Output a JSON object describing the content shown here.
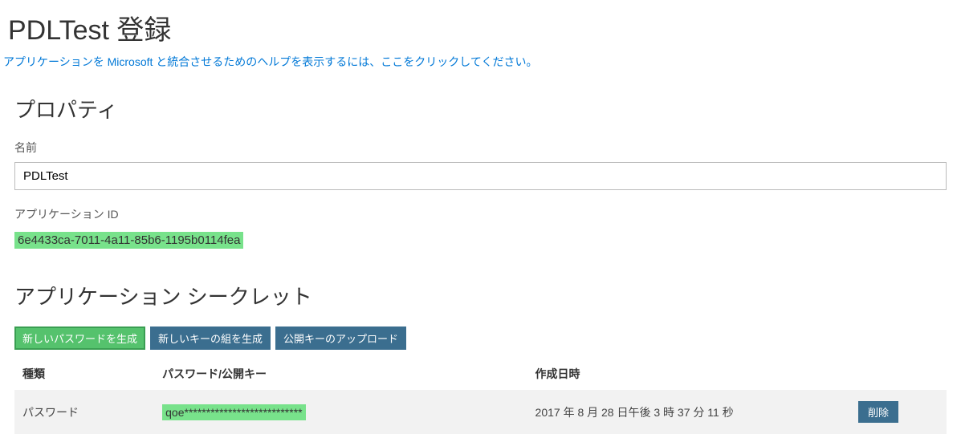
{
  "header": {
    "title": "PDLTest 登録",
    "help_link": "アプリケーションを Microsoft と統合させるためのヘルプを表示するには、ここをクリックしてください。"
  },
  "properties": {
    "section_title": "プロパティ",
    "name_label": "名前",
    "name_value": "PDLTest",
    "app_id_label": "アプリケーション ID",
    "app_id_value": "6e4433ca-7011-4a11-85b6-1195b0114fea"
  },
  "secrets": {
    "section_title": "アプリケーション シークレット",
    "buttons": {
      "new_password": "新しいパスワードを生成",
      "new_keypair": "新しいキーの組を生成",
      "upload_key": "公開キーのアップロード"
    },
    "columns": {
      "type": "種類",
      "key": "パスワード/公開キー",
      "created": "作成日時"
    },
    "row": {
      "type": "パスワード",
      "key": "qoe***************************",
      "created": "2017 年 8 月 28 日午後 3 時 37 分 11 秒",
      "delete_label": "削除"
    }
  }
}
